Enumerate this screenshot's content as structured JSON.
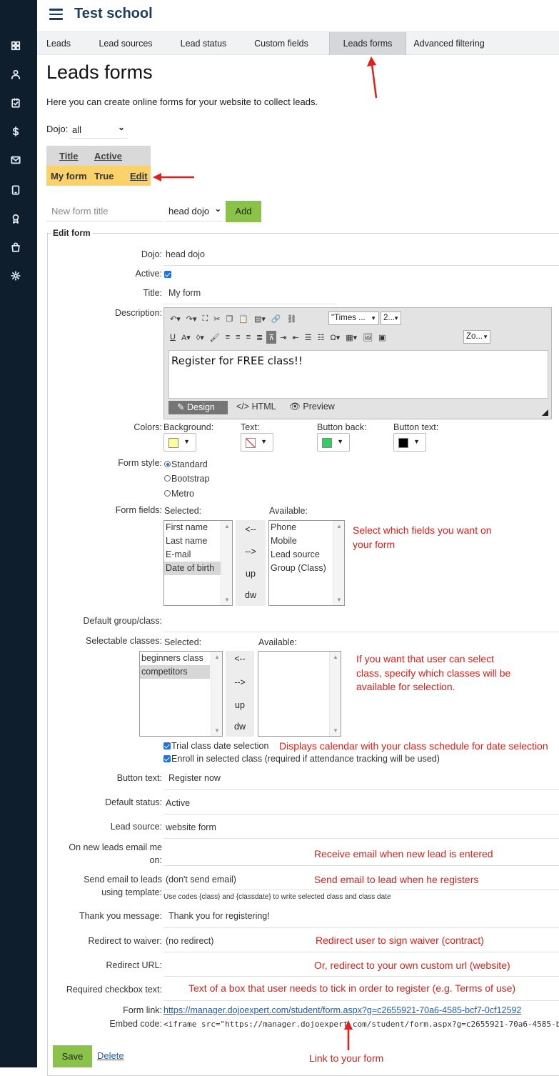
{
  "app": {
    "school_name": "Test school"
  },
  "sidebar": {
    "icons": [
      "dashboard-icon",
      "person-icon",
      "clipboard-check-icon",
      "dollar-icon",
      "mail-icon",
      "tablet-icon",
      "award-icon",
      "shopping-bag-icon",
      "gear-icon"
    ]
  },
  "tabs": [
    {
      "label": "Leads",
      "active": false
    },
    {
      "label": "Lead sources",
      "active": false
    },
    {
      "label": "Lead status",
      "active": false
    },
    {
      "label": "Custom fields",
      "active": false
    },
    {
      "label": "Leads forms",
      "active": true
    },
    {
      "label": "Advanced filtering",
      "active": false
    }
  ],
  "page": {
    "title": "Leads forms",
    "intro": "Here you can create online forms for your website to collect leads.",
    "dojo_filter_label": "Dojo:",
    "dojo_filter_value": "all"
  },
  "forms_table": {
    "headers": [
      "Title",
      "Active"
    ],
    "rows": [
      {
        "title": "My form",
        "active": "True",
        "action": "Edit"
      }
    ]
  },
  "new_form": {
    "placeholder": "New form title",
    "dojo": "head dojo",
    "add_label": "Add"
  },
  "edit_form": {
    "legend": "Edit form",
    "dojo": {
      "label": "Dojo:",
      "value": "head dojo"
    },
    "active": {
      "label": "Active:",
      "checked": true
    },
    "title": {
      "label": "Title:",
      "value": "My form"
    },
    "description": {
      "label": "Description:",
      "font_name": "\"Times ...",
      "font_size": "2...",
      "zoom": "Zo...",
      "content": "Register for FREE class!!",
      "tab_design": "Design",
      "tab_html": "HTML",
      "tab_preview": "Preview"
    },
    "colors": {
      "label": "Colors:",
      "background_label": "Background:",
      "background": "#ffff99",
      "text_label": "Text:",
      "button_back_label": "Button back:",
      "button_back": "#33cc66",
      "button_text_label": "Button text:",
      "button_text": "#000000"
    },
    "form_style": {
      "label": "Form style:",
      "options": [
        "Standard",
        "Bootstrap",
        "Metro"
      ],
      "selected": "Standard"
    },
    "form_fields": {
      "label": "Form fields:",
      "selected_label": "Selected:",
      "available_label": "Available:",
      "selected": [
        "First name",
        "Last name",
        "E-mail",
        "Date of birth"
      ],
      "highlighted": "Date of birth",
      "available": [
        "Phone",
        "Mobile",
        "Lead source",
        "Group (Class)"
      ],
      "btn_left": "<--",
      "btn_right": "-->",
      "btn_up": "up",
      "btn_down": "dw"
    },
    "default_group": {
      "label": "Default group/class:"
    },
    "selectable_classes": {
      "label": "Selectable classes:",
      "selected_label": "Selected:",
      "available_label": "Available:",
      "selected": [
        "beginners class",
        "competitors"
      ],
      "highlighted": "competitors",
      "available": [],
      "btn_left": "<--",
      "btn_right": "-->",
      "btn_up": "up",
      "btn_down": "dw"
    },
    "trial_class": {
      "label": "Trial class date selection",
      "checked": true
    },
    "enroll_class": {
      "label": "Enroll in selected class (required if attendance tracking will be used)",
      "checked": true
    },
    "button_text": {
      "label": "Button text:",
      "value": "Register now"
    },
    "default_status": {
      "label": "Default status:",
      "value": "Active"
    },
    "lead_source": {
      "label": "Lead source:",
      "value": "website form"
    },
    "email_me": {
      "label_1": "On new leads email me",
      "label_2": "on:"
    },
    "send_email": {
      "label_1": "Send email to leads",
      "label_2": "using template:",
      "value": "(don't send email)",
      "hint": "Use codes {class} and {classdate} to write selected class and class date"
    },
    "thank_you": {
      "label": "Thank you message:",
      "value": "Thank you for registering!"
    },
    "redirect_waiver": {
      "label": "Redirect to waiver:",
      "value": "(no redirect)"
    },
    "redirect_url": {
      "label": "Redirect URL:"
    },
    "required_checkbox": {
      "label": "Required checkbox text:"
    },
    "form_link": {
      "label": "Form link:",
      "value": "https://manager.dojoexpert.com/student/form.aspx?g=c2655921-70a6-4585-bcf7-0cf12592"
    },
    "embed_code": {
      "label": "Embed code:",
      "value": "<iframe src=\"https://manager.dojoexpert.com/student/form.aspx?g=c2655921-70a6-4585-b"
    },
    "save_label": "Save",
    "delete_label": "Delete"
  },
  "annotations": {
    "fields": [
      "Select which fields you want on",
      "your form"
    ],
    "classes": [
      "If you want that user can select",
      "class, specify which classes will be",
      "available for selection."
    ],
    "calendar": "Displays calendar with your class schedule for date selection",
    "email_me": "Receive email when new lead is entered",
    "send_email": "Send email to lead when he registers",
    "waiver": "Redirect user to sign waiver (contract)",
    "redirect": "Or, redirect to your own custom url (website)",
    "checkbox": "Text of a box that user needs to tick in order to register (e.g. Terms of use)",
    "link": "Link to your form"
  }
}
